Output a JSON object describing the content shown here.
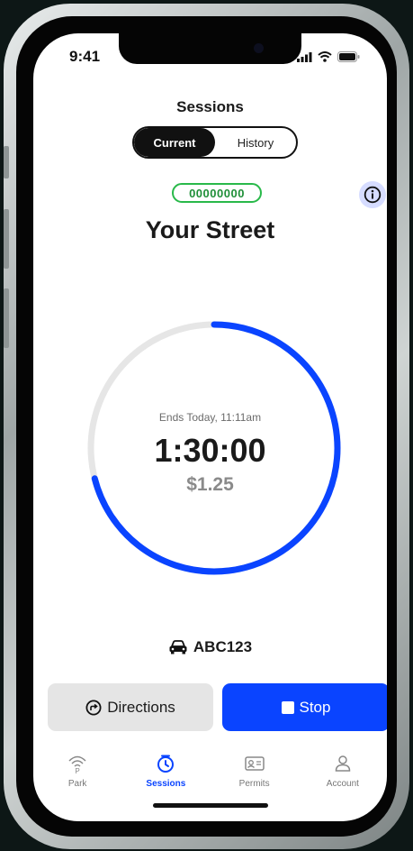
{
  "status_bar": {
    "time": "9:41",
    "icons": [
      "signal-icon",
      "wifi-icon",
      "battery-icon"
    ]
  },
  "header": {
    "title": "Sessions"
  },
  "segment": {
    "options": [
      "Current",
      "History"
    ],
    "selected": "Current"
  },
  "session": {
    "zone_code": "00000000",
    "street": "Your Street",
    "ends_text": "Ends Today, 11:11am",
    "time_remaining": "1:30:00",
    "cost": "$1.25",
    "progress_fraction": 0.71,
    "vehicle_plate": "ABC123"
  },
  "actions": {
    "directions_label": "Directions",
    "stop_label": "Stop"
  },
  "tabs": [
    {
      "label": "Park",
      "icon": "park-icon",
      "active": false
    },
    {
      "label": "Sessions",
      "icon": "timer-icon",
      "active": true
    },
    {
      "label": "Permits",
      "icon": "id-card-icon",
      "active": false
    },
    {
      "label": "Account",
      "icon": "person-icon",
      "active": false
    }
  ],
  "colors": {
    "accent": "#0a44ff",
    "zone_green": "#29b94a",
    "track": "#e6e6e6"
  }
}
